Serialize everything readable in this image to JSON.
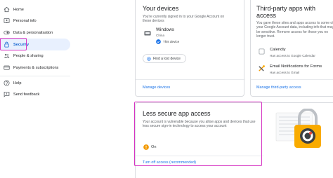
{
  "sidebar": {
    "items": [
      {
        "label": "Home",
        "icon": "home-icon"
      },
      {
        "label": "Personal info",
        "icon": "person-icon"
      },
      {
        "label": "Data & personalisation",
        "icon": "toggle-icon"
      },
      {
        "label": "Security",
        "icon": "lock-icon",
        "active": true
      },
      {
        "label": "People & sharing",
        "icon": "people-icon"
      },
      {
        "label": "Payments & subscriptions",
        "icon": "card-icon"
      },
      {
        "label": "Help",
        "icon": "help-icon"
      },
      {
        "label": "Send feedback",
        "icon": "feedback-icon"
      }
    ]
  },
  "devices_card": {
    "title": "Your devices",
    "desc": "You're currently signed in to your Google Account on these devices",
    "device_name": "Windows",
    "device_location": "China",
    "device_status": "This device",
    "find_button": "Find a lost device",
    "manage_link": "Manage devices"
  },
  "third_party_card": {
    "title_line1": "Third-party apps with",
    "title_line2": "access",
    "desc": "You gave these sites and apps access to some of your Google Account data, including info that may be sensitive. Remove access for those you no longer trust.",
    "apps": [
      {
        "name": "Calendly",
        "detail": "Has access to Google Calendar"
      },
      {
        "name": "Email Notifications for Forms",
        "detail": "Has access to Gmail"
      }
    ],
    "manage_link": "Manage third-party access"
  },
  "less_secure_card": {
    "title": "Less secure app access",
    "desc": "Your account is vulnerable because you allow apps and devices that use less secure sign-in technology to access your account",
    "status": "On",
    "link": "Turn off access (recommended)"
  },
  "colors": {
    "accent": "#1a73e8",
    "highlight": "#d633c2",
    "warning": "#f29900",
    "lock_orange": "#f9ab00"
  }
}
